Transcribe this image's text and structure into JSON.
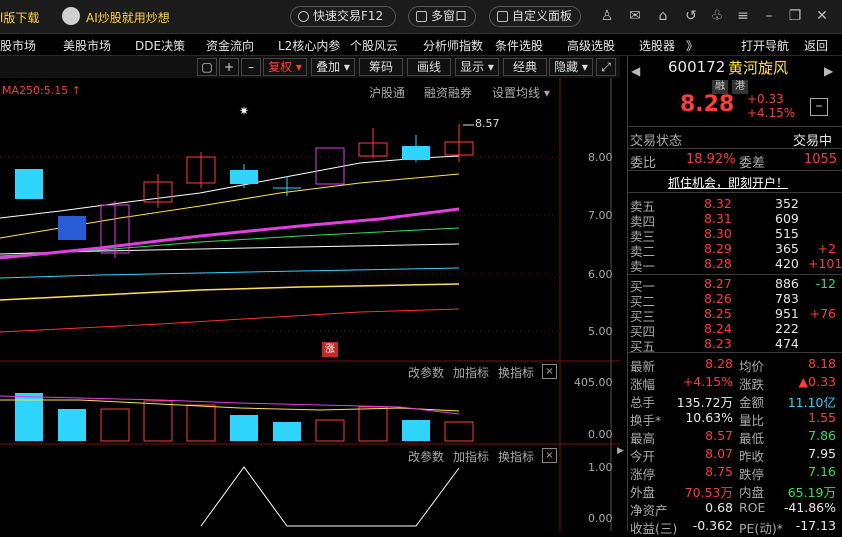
{
  "topbar": {
    "left_label": "l版下载",
    "ai_label": "AI炒股就用炒想",
    "quick_trade": "快速交易F12",
    "multi_window": "多窗口",
    "custom_panel": "自定义面板"
  },
  "menu": [
    "股市场",
    "美股市场",
    "DDE决策",
    "资金流向",
    "L2核心内参",
    "个股风云",
    "分析师指数",
    "条件选股",
    "高级选股",
    "选股器",
    "》",
    "打开导航",
    "返回"
  ],
  "chart_toolbar": {
    "fuquan": "复权",
    "diejia": "叠加",
    "chouma": "筹码",
    "huaxian": "画线",
    "xianshi": "显示",
    "jingdian": "经典",
    "yincang": "隐藏"
  },
  "chart": {
    "ma_label": "MA250:5.15 ↑",
    "links": [
      "沪股通",
      "融资融券",
      "设置均线"
    ],
    "max_label": "8.57",
    "price_axis": [
      "8.00",
      "7.00",
      "6.00",
      "5.00"
    ],
    "limit_badge": "涨",
    "vol_axis": [
      "405.00",
      "0.00"
    ],
    "ind_axis": [
      "1.00",
      "0.00"
    ],
    "sub_links": [
      "改参数",
      "加指标",
      "换指标"
    ],
    "close_x": "×"
  },
  "quote": {
    "code": "600172",
    "name": "黄河旋风",
    "badge1": "融",
    "badge2": "港",
    "price": "8.28",
    "change": "+0.33",
    "change_pct": "+4.15%",
    "status_label": "交易状态",
    "status_value": "交易中",
    "weibi_label": "委比",
    "weibi_value": "18.92%",
    "weicha_label": "委差",
    "weicha_value": "1055",
    "banner": "抓住机会，即刻开户！"
  },
  "asks": [
    {
      "label": "卖五",
      "price": "8.32",
      "vol": "352",
      "chg": ""
    },
    {
      "label": "卖四",
      "price": "8.31",
      "vol": "609",
      "chg": ""
    },
    {
      "label": "卖三",
      "price": "8.30",
      "vol": "515",
      "chg": ""
    },
    {
      "label": "卖二",
      "price": "8.29",
      "vol": "365",
      "chg": "+2"
    },
    {
      "label": "卖一",
      "price": "8.28",
      "vol": "420",
      "chg": "+101"
    }
  ],
  "bids": [
    {
      "label": "买一",
      "price": "8.27",
      "vol": "886",
      "chg": "-12"
    },
    {
      "label": "买二",
      "price": "8.26",
      "vol": "783",
      "chg": ""
    },
    {
      "label": "买三",
      "price": "8.25",
      "vol": "951",
      "chg": "+76"
    },
    {
      "label": "买四",
      "price": "8.24",
      "vol": "222",
      "chg": ""
    },
    {
      "label": "买五",
      "price": "8.23",
      "vol": "474",
      "chg": ""
    }
  ],
  "stats": [
    {
      "l1": "最新",
      "v1": "8.28",
      "c1": "red",
      "l2": "均价",
      "v2": "8.18",
      "c2": "red"
    },
    {
      "l1": "涨幅",
      "v1": "+4.15%",
      "c1": "red",
      "l2": "涨跌",
      "v2": "▲0.33",
      "c2": "red"
    },
    {
      "l1": "总手",
      "v1": "135.72万",
      "c1": "white",
      "l2": "金额",
      "v2": "11.10亿",
      "c2": "cyan"
    },
    {
      "l1": "换手*",
      "v1": "10.63%",
      "c1": "white",
      "l2": "量比",
      "v2": "1.55",
      "c2": "red"
    },
    {
      "l1": "最高",
      "v1": "8.57",
      "c1": "red",
      "l2": "最低",
      "v2": "7.86",
      "c2": "green"
    },
    {
      "l1": "今开",
      "v1": "8.07",
      "c1": "red",
      "l2": "昨收",
      "v2": "7.95",
      "c2": "white"
    },
    {
      "l1": "涨停",
      "v1": "8.75",
      "c1": "red",
      "l2": "跌停",
      "v2": "7.16",
      "c2": "green"
    },
    {
      "l1": "外盘",
      "v1": "70.53万",
      "c1": "red",
      "l2": "内盘",
      "v2": "65.19万",
      "c2": "green"
    },
    {
      "l1": "净资产",
      "v1": "0.68",
      "c1": "white",
      "l2": "ROE",
      "v2": "-41.86%",
      "c2": "white"
    },
    {
      "l1": "收益(三)",
      "v1": "-0.362",
      "c1": "white",
      "l2": "PE(动)*",
      "v2": "-17.13",
      "c2": "white"
    }
  ],
  "colors": {
    "up": "#ff3b3b",
    "down": "#2fe05a",
    "cyan": "#2fd4ff",
    "magenta": "#e040e0",
    "yellow": "#ffe24a"
  }
}
